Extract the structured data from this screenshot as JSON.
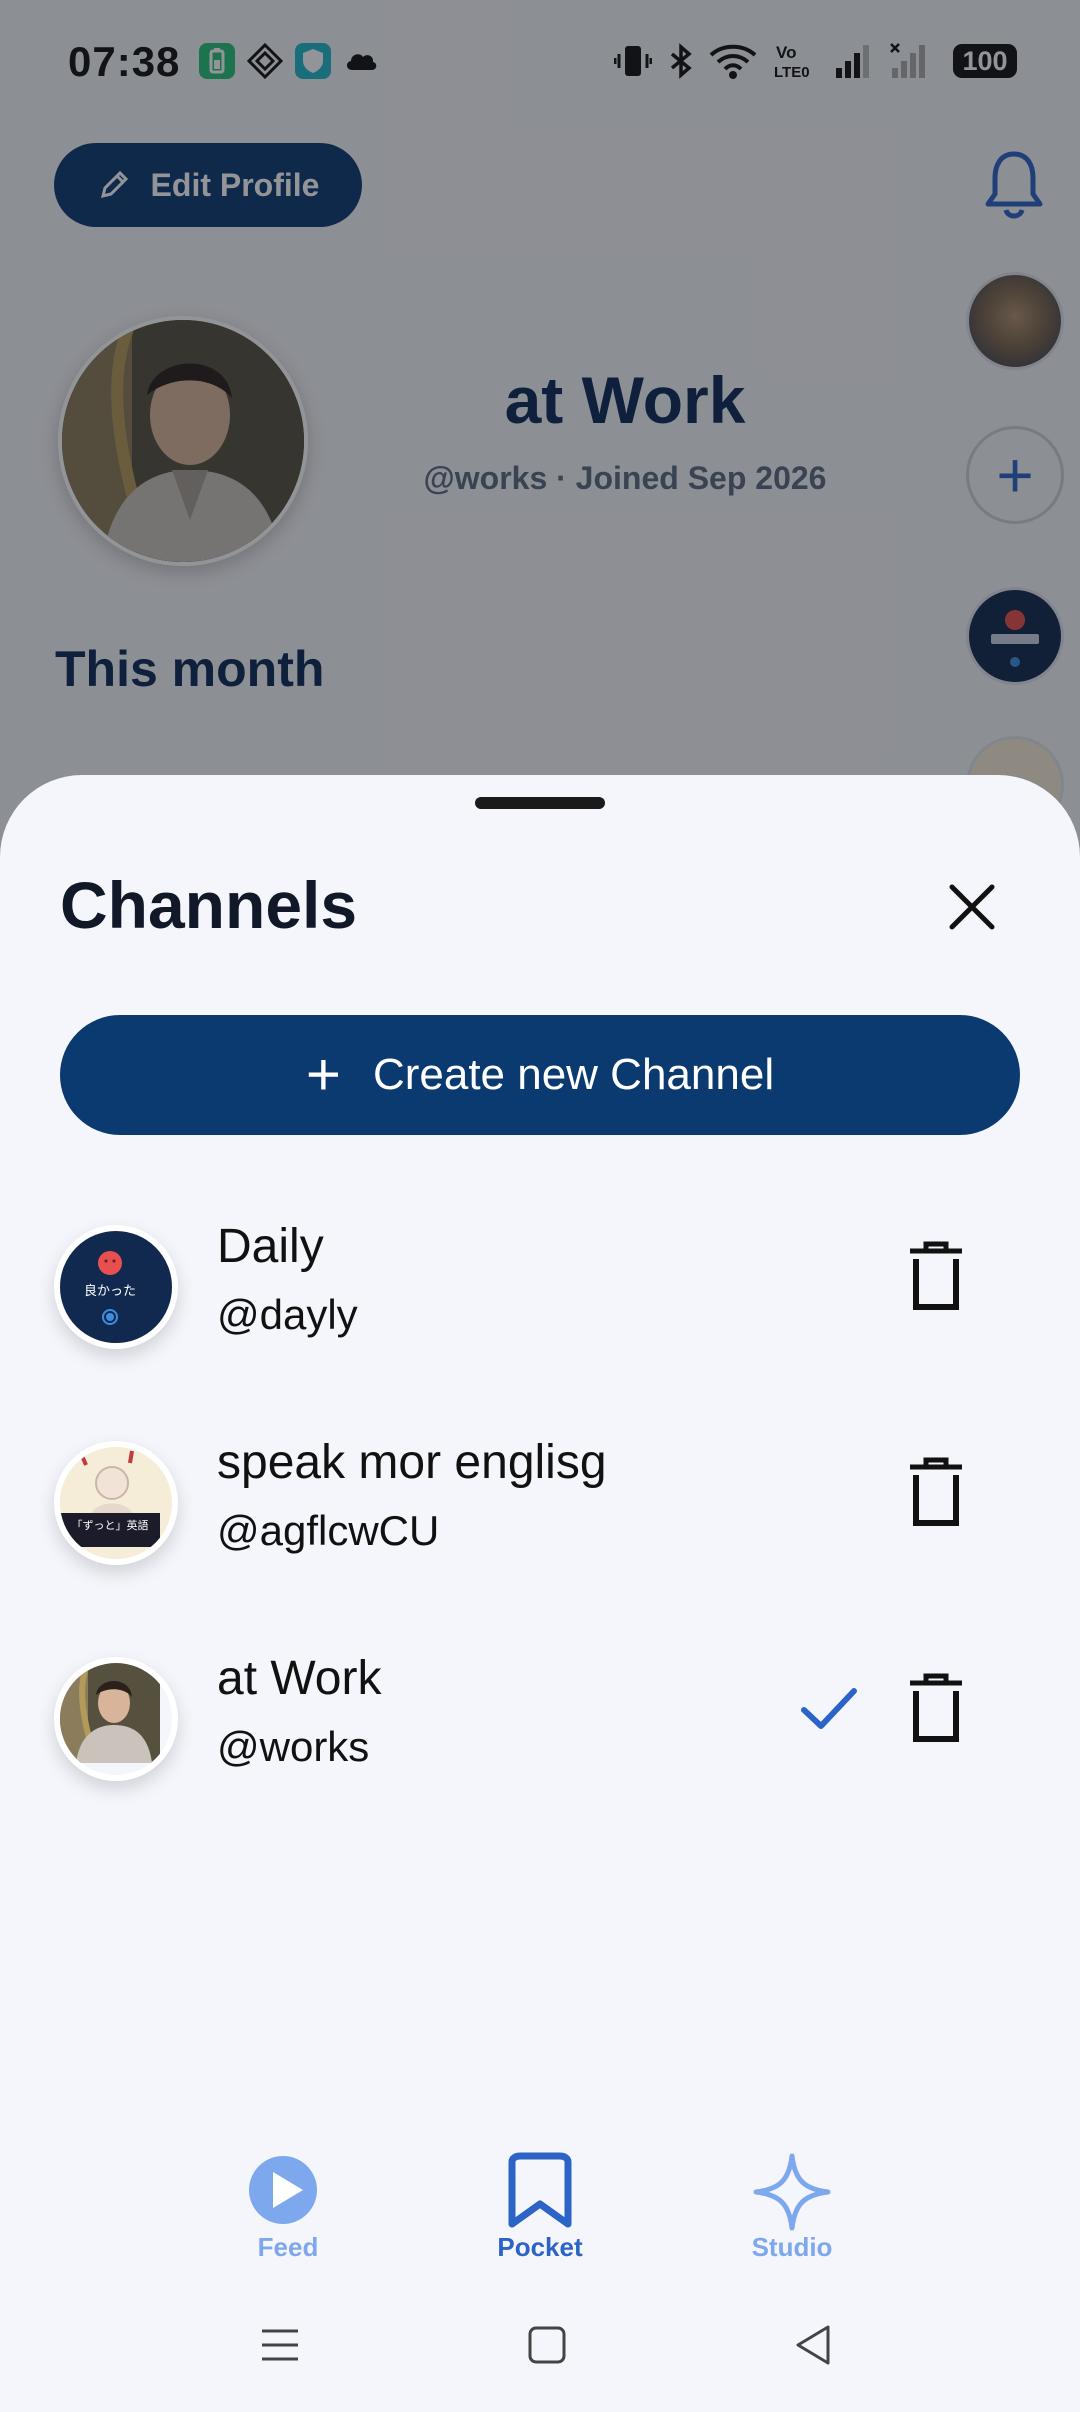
{
  "status_bar": {
    "time": "07:38",
    "battery": "100",
    "left_icons": [
      "battery-saver-icon",
      "diamond-icon",
      "shield-icon",
      "cloud-icon"
    ],
    "right_icons": [
      "vibrate-icon",
      "bluetooth-icon",
      "wifi-icon",
      "volte-icon",
      "signal-icon",
      "signal-no-service-icon",
      "battery-icon"
    ]
  },
  "profile": {
    "edit_label": "Edit Profile",
    "name": "at Work",
    "handle_joined": "@works · Joined Sep 2026",
    "this_month": "This month"
  },
  "sheet": {
    "title": "Channels",
    "create_label": "Create new Channel",
    "channels": [
      {
        "name": "Daily",
        "handle": "@dayly",
        "selected": false,
        "avatar_text": "良かった"
      },
      {
        "name": "speak mor englisg",
        "handle": "@agflcwCU",
        "selected": false,
        "avatar_text": "「ずっと」英語"
      },
      {
        "name": "at Work",
        "handle": "@works",
        "selected": true,
        "avatar_text": ""
      }
    ]
  },
  "bottom_nav": {
    "items": [
      {
        "label": "Feed",
        "icon": "play-icon",
        "active": false
      },
      {
        "label": "Pocket",
        "icon": "bookmark-icon",
        "active": true
      },
      {
        "label": "Studio",
        "icon": "sparkle-icon",
        "active": false
      }
    ]
  },
  "colors": {
    "primary": "#0b3a70",
    "accent": "#2b63c6",
    "nav_inactive": "#7ea8ee",
    "sheet_bg": "#f4f6fb"
  }
}
